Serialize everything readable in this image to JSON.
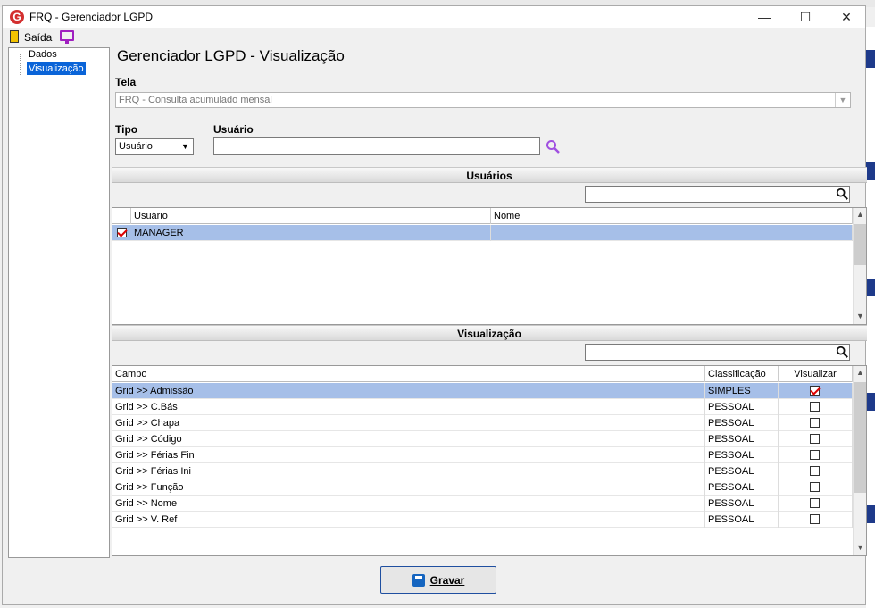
{
  "window": {
    "title": "FRQ - Gerenciador LGPD",
    "logo_letter": "G"
  },
  "toolbar": {
    "exit_label": "Saída"
  },
  "tree": {
    "items": [
      {
        "label": "Dados"
      },
      {
        "label": "Visualização"
      }
    ]
  },
  "page": {
    "title": "Gerenciador LGPD - Visualização"
  },
  "form": {
    "tela_label": "Tela",
    "tela_value": "FRQ - Consulta acumulado mensal",
    "tipo_label": "Tipo",
    "tipo_value": "Usuário",
    "usuario_label": "Usuário",
    "usuario_value": ""
  },
  "usuarios": {
    "section_title": "Usuários",
    "filter_value": "",
    "columns": [
      "Usuário",
      "Nome"
    ],
    "rows": [
      {
        "checked": true,
        "usuario": "MANAGER",
        "nome": ""
      }
    ]
  },
  "visualizacao": {
    "section_title": "Visualização",
    "filter_value": "",
    "columns": [
      "Campo",
      "Classificação",
      "Visualizar"
    ],
    "rows": [
      {
        "campo": "Grid >> Admissão",
        "classificacao": "SIMPLES",
        "visualizar": true
      },
      {
        "campo": "Grid >> C.Bás",
        "classificacao": "PESSOAL",
        "visualizar": false
      },
      {
        "campo": "Grid >> Chapa",
        "classificacao": "PESSOAL",
        "visualizar": false
      },
      {
        "campo": "Grid >> Código",
        "classificacao": "PESSOAL",
        "visualizar": false
      },
      {
        "campo": "Grid >> Férias Fin",
        "classificacao": "PESSOAL",
        "visualizar": false
      },
      {
        "campo": "Grid >> Férias Ini",
        "classificacao": "PESSOAL",
        "visualizar": false
      },
      {
        "campo": "Grid >> Função",
        "classificacao": "PESSOAL",
        "visualizar": false
      },
      {
        "campo": "Grid >> Nome",
        "classificacao": "PESSOAL",
        "visualizar": false
      },
      {
        "campo": "Grid >> V. Ref",
        "classificacao": "PESSOAL",
        "visualizar": false
      }
    ]
  },
  "footer": {
    "save_label": "Gravar"
  },
  "colors": {
    "selection": "#a6bfe8",
    "accent": "#1f4fa0",
    "tree_selection": "#0a64d8",
    "check": "#dd0000"
  }
}
